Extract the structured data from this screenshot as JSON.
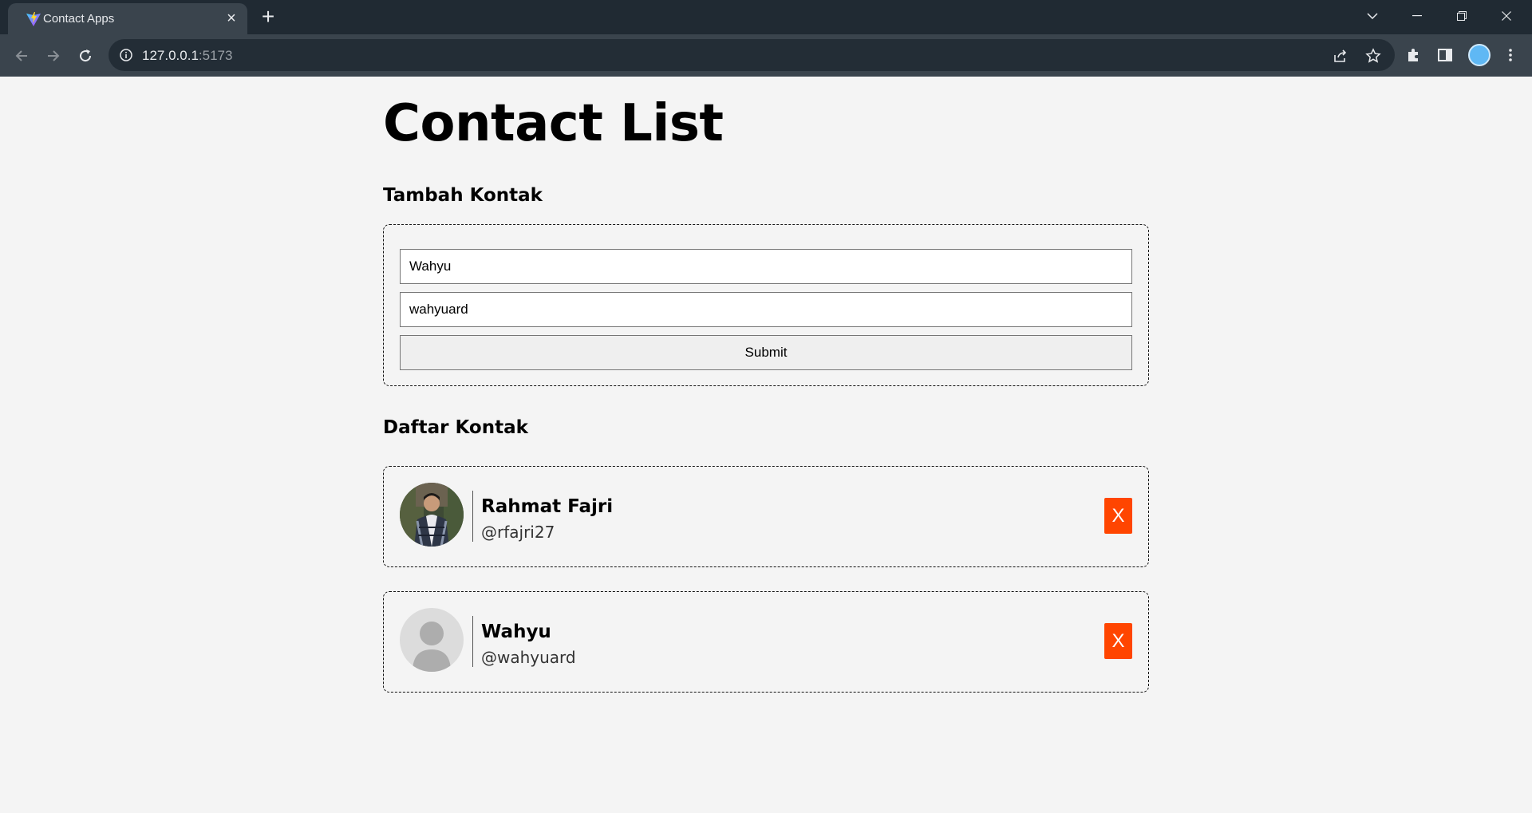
{
  "browser": {
    "tab_title": "Contact Apps",
    "url_host": "127.0.0.1",
    "url_port": ":5173"
  },
  "page": {
    "title": "Contact List",
    "add_section_title": "Tambah Kontak",
    "list_section_title": "Daftar Kontak",
    "form": {
      "name_value": "Wahyu",
      "username_value": "wahyuard",
      "submit_label": "Submit"
    },
    "contacts": [
      {
        "name": "Rahmat Fajri",
        "handle": "@rfajri27",
        "avatar": "photo-avatar",
        "delete_label": "X"
      },
      {
        "name": "Wahyu",
        "handle": "@wahyuard",
        "avatar": "default-user-avatar",
        "delete_label": "X"
      }
    ]
  },
  "colors": {
    "page_bg": "#f4f4f4",
    "delete_button": "#ff4500",
    "chrome_dark": "#202a33",
    "chrome_toolbar": "#3a444d"
  }
}
